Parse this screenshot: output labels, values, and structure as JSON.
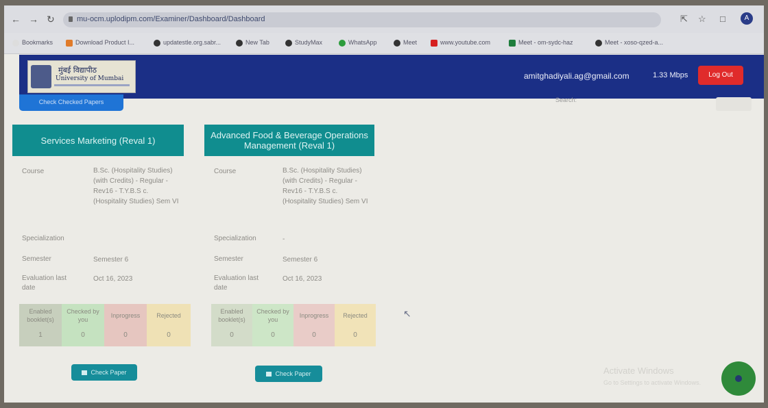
{
  "browser": {
    "url": "mu-ocm.uplodipm.com/Examiner/Dashboard/Dashboard",
    "bookmarks": [
      "Bookmarks",
      "Download Product I...",
      "updatestle.org.sabr...",
      "New Tab",
      "StudyMax",
      "WhatsApp",
      "Meet",
      "www.youtube.com",
      "Meet - om-sydc-haz",
      "Meet - xoso-qzed-a..."
    ]
  },
  "header": {
    "logo_line1": "मुंबई विद्यापीठ",
    "logo_line2": "University of Mumbai",
    "email": "amitghadiyali.ag@gmail.com",
    "speed": "1.33 Mbps",
    "logout_label": "Log Out",
    "top_button_label": "Check Checked Papers",
    "search_label": "Search:"
  },
  "cards": [
    {
      "title": "Services Marketing  (Reval 1)",
      "course_label": "Course",
      "course_value": "B.Sc. (Hospitality Studies)(with Credits) - Regular - Rev16 - T.Y.B.S c. (Hospitality Studies) Sem VI",
      "spec_label": "Specialization",
      "spec_value": "",
      "sem_label": "Semester",
      "sem_value": "Semester 6",
      "eval_label": "Evaluation last date",
      "eval_value": "Oct 16, 2023",
      "stats": [
        {
          "label": "Enabled booklet(s)",
          "value": "1",
          "color": "#c7cfbd"
        },
        {
          "label": "Checked by you",
          "value": "0",
          "color": "#c5e2c0"
        },
        {
          "label": "Inprogress",
          "value": "0",
          "color": "#e6c6c0"
        },
        {
          "label": "Rejected",
          "value": "0",
          "color": "#efe1b5"
        }
      ],
      "button_label": "Check Paper"
    },
    {
      "title": "Advanced Food & Beverage Operations Management  (Reval 1)",
      "course_label": "Course",
      "course_value": "B.Sc. (Hospitality Studies)(with Credits) - Regular - Rev16 - T.Y.B.S c. (Hospitality Studies) Sem VI",
      "spec_label": "Specialization",
      "spec_value": "-",
      "sem_label": "Semester",
      "sem_value": "Semester 6",
      "eval_label": "Evaluation last date",
      "eval_value": "Oct 16, 2023",
      "stats": [
        {
          "label": "Enabled booklet(s)",
          "value": "0",
          "color": "#d3dcc9"
        },
        {
          "label": "Checked by you",
          "value": "0",
          "color": "#cde6c7"
        },
        {
          "label": "Inprogress",
          "value": "0",
          "color": "#e9ccc8"
        },
        {
          "label": "Rejected",
          "value": "0",
          "color": "#f1e3b8"
        }
      ],
      "button_label": "Check Paper"
    }
  ],
  "watermark": {
    "line1": "Activate Windows",
    "line2": "Go to Settings to activate Windows."
  },
  "icons": [
    "back-icon",
    "forward-icon",
    "reload-icon",
    "lock-icon",
    "share-icon",
    "star-icon",
    "chat-icon",
    "paper-icon"
  ]
}
